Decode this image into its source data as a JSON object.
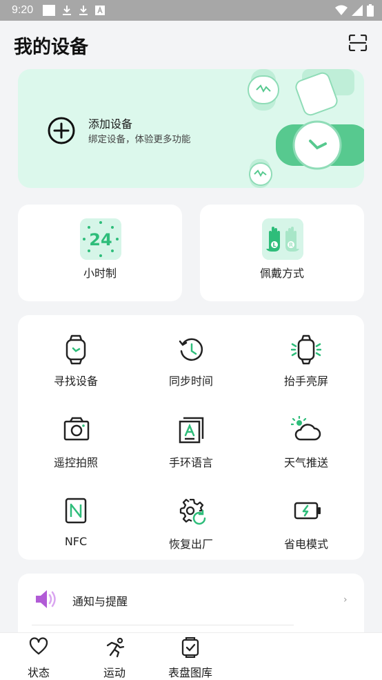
{
  "status_bar": {
    "time": "9:20"
  },
  "header": {
    "title": "我的设备",
    "scan_icon": "scan-icon"
  },
  "add_device": {
    "title": "添加设备",
    "subtitle": "绑定设备，体验更多功能"
  },
  "quick_settings": [
    {
      "label": "小时制",
      "badge": "24",
      "icon": "clock-24-icon"
    },
    {
      "label": "佩戴方式",
      "icon": "hands-icon"
    }
  ],
  "features": [
    {
      "label": "寻找设备",
      "icon": "watch-icon"
    },
    {
      "label": "同步时间",
      "icon": "history-clock-icon"
    },
    {
      "label": "抬手亮屏",
      "icon": "watch-glow-icon"
    },
    {
      "label": "遥控拍照",
      "icon": "camera-icon"
    },
    {
      "label": "手环语言",
      "icon": "language-icon"
    },
    {
      "label": "天气推送",
      "icon": "weather-icon"
    },
    {
      "label": "NFC",
      "icon": "nfc-icon"
    },
    {
      "label": "恢复出厂",
      "icon": "gear-reset-icon"
    },
    {
      "label": "省电模式",
      "icon": "battery-icon"
    }
  ],
  "notification": {
    "label": "通知与提醒",
    "icon": "speaker-icon"
  },
  "tabs": [
    {
      "label": "状态",
      "icon": "heart-icon"
    },
    {
      "label": "运动",
      "icon": "running-icon"
    },
    {
      "label": "表盘图库",
      "icon": "watchface-icon"
    }
  ],
  "colors": {
    "accent": "#2ebd7a",
    "card_tint": "#dcf8ec",
    "speaker": "#b15bd6"
  }
}
